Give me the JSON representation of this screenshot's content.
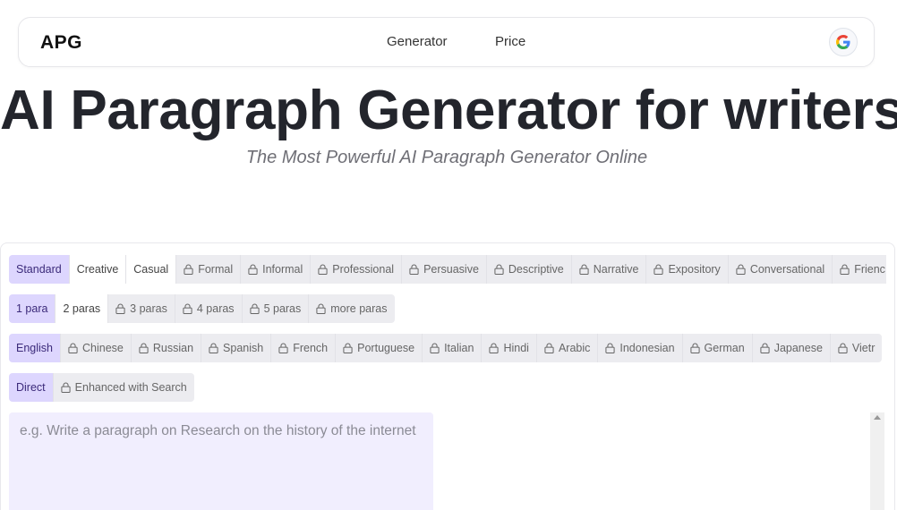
{
  "nav": {
    "logo": "APG",
    "links": [
      "Generator",
      "Price"
    ],
    "google_icon": "google-g-icon"
  },
  "hero": {
    "title": "AI Paragraph Generator for writers",
    "subtitle": "The Most Powerful AI Paragraph Generator Online"
  },
  "styles": [
    {
      "label": "Standard",
      "state": "selected"
    },
    {
      "label": "Creative",
      "state": "plain"
    },
    {
      "label": "Casual",
      "state": "plain"
    },
    {
      "label": "Formal",
      "state": "locked"
    },
    {
      "label": "Informal",
      "state": "locked"
    },
    {
      "label": "Professional",
      "state": "locked"
    },
    {
      "label": "Persuasive",
      "state": "locked"
    },
    {
      "label": "Descriptive",
      "state": "locked"
    },
    {
      "label": "Narrative",
      "state": "locked"
    },
    {
      "label": "Expository",
      "state": "locked"
    },
    {
      "label": "Conversational",
      "state": "locked"
    },
    {
      "label": "Frienc",
      "state": "locked"
    }
  ],
  "lengths": [
    {
      "label": "1 para",
      "state": "selected"
    },
    {
      "label": "2 paras",
      "state": "plain"
    },
    {
      "label": "3 paras",
      "state": "locked"
    },
    {
      "label": "4 paras",
      "state": "locked"
    },
    {
      "label": "5 paras",
      "state": "locked"
    },
    {
      "label": "more paras",
      "state": "locked"
    }
  ],
  "languages": [
    {
      "label": "English",
      "state": "selected"
    },
    {
      "label": "Chinese",
      "state": "locked"
    },
    {
      "label": "Russian",
      "state": "locked"
    },
    {
      "label": "Spanish",
      "state": "locked"
    },
    {
      "label": "French",
      "state": "locked"
    },
    {
      "label": "Portuguese",
      "state": "locked"
    },
    {
      "label": "Italian",
      "state": "locked"
    },
    {
      "label": "Hindi",
      "state": "locked"
    },
    {
      "label": "Arabic",
      "state": "locked"
    },
    {
      "label": "Indonesian",
      "state": "locked"
    },
    {
      "label": "German",
      "state": "locked"
    },
    {
      "label": "Japanese",
      "state": "locked"
    },
    {
      "label": "Vietr",
      "state": "locked"
    }
  ],
  "modes": [
    {
      "label": "Direct",
      "state": "selected"
    },
    {
      "label": "Enhanced with Search",
      "state": "locked"
    }
  ],
  "prompt": {
    "placeholder": "e.g. Write a paragraph on Research on the history of the internet"
  },
  "colors": {
    "selected_bg": "#ddd6fe",
    "prompt_bg": "#f1eefe"
  }
}
